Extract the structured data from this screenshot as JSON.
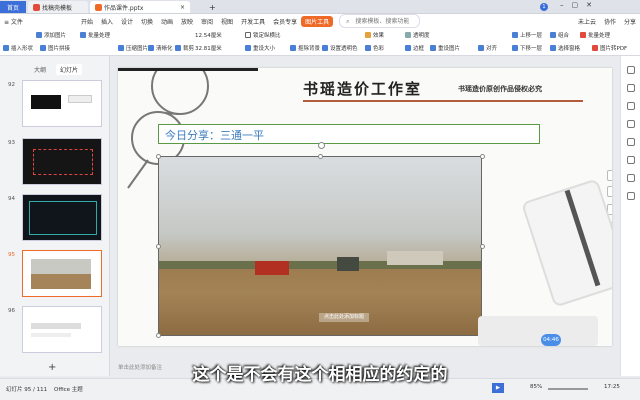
{
  "titlebar": {
    "home_tab": "首页",
    "tab1": "找稿壳模板",
    "tab2": "作品课件.pptx",
    "plus": "+",
    "right_badge": "1"
  },
  "menubar": {
    "file": "≡ 文件",
    "items": [
      "开始",
      "插入",
      "设计",
      "切换",
      "动画",
      "放映",
      "审阅",
      "视图",
      "开发工具",
      "会员专享"
    ],
    "active": "图片工具",
    "search": "搜索模板、搜索功能",
    "right": [
      "未上云",
      "协作",
      "分享"
    ]
  },
  "toolbar": {
    "r1": [
      "添加图片",
      "批量处理",
      "12.54厘米",
      "锁定纵横比",
      "效果",
      "透明度",
      "上移一层",
      "组合",
      "批量处理"
    ],
    "r2": [
      "插入形状",
      "图片拼接",
      "压缩图片",
      "清晰化",
      "裁剪",
      "32.81厘米",
      "重设大小",
      "抠除背景",
      "设置透明色",
      "色彩",
      "边框",
      "重设图片",
      "对齐",
      "下移一层",
      "选择窗格",
      "图片转PDF"
    ]
  },
  "leftpane": {
    "tabs": [
      "大纲",
      "幻灯片"
    ],
    "slides": [
      "92",
      "93",
      "94",
      "95",
      "96"
    ],
    "add_label": "+"
  },
  "slide": {
    "title": "书瑶造价工作室",
    "subtitle": "书瑶造价原创作品侵权必究",
    "share_text": "今日分享：三通一平",
    "watermark": "点击此处添加标题",
    "time_badge": "04:46"
  },
  "notes": {
    "placeholder": "单击此处添加备注"
  },
  "status": {
    "slide_info": "幻灯片 95 / 111",
    "theme": "Office 主题",
    "zoom": "85%",
    "clock": "17:25"
  },
  "subtitle_caption": "这个是不会有这个相相应的约定的",
  "colors": {
    "accent": "#f06a27",
    "green_box": "#5b9a45",
    "title_brown": "#7a4a22"
  }
}
